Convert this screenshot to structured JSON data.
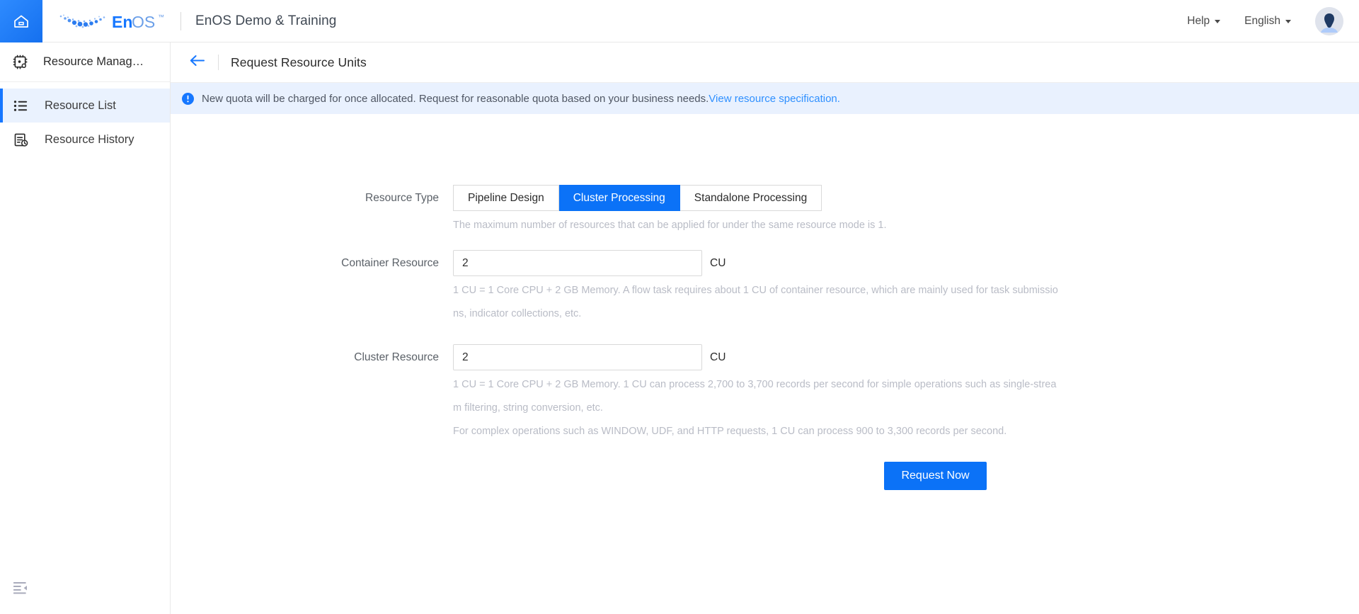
{
  "topbar": {
    "home_icon": "home-icon",
    "logo_text": "EnOS",
    "logo_tm": "™",
    "tenant_title": "EnOS Demo & Training",
    "help_label": "Help",
    "language_label": "English",
    "avatar_icon": "user-avatar-icon"
  },
  "sidebar": {
    "module_icon": "resource-chip-icon",
    "module_title": "Resource Manag…",
    "items": [
      {
        "label": "Resource List",
        "icon": "list-icon",
        "active": true
      },
      {
        "label": "Resource History",
        "icon": "history-document-icon",
        "active": false
      }
    ],
    "collapse_icon": "collapse-sidebar-icon"
  },
  "page": {
    "back_icon": "back-arrow-icon",
    "title": "Request Resource Units"
  },
  "notice": {
    "icon": "info-circle-icon",
    "text": "New quota will be charged for once allocated. Request for reasonable quota based on your business needs.",
    "link_text": "View resource specification."
  },
  "form": {
    "resource_type": {
      "label": "Resource Type",
      "options": [
        {
          "label": "Pipeline Design",
          "selected": false
        },
        {
          "label": "Cluster Processing",
          "selected": true
        },
        {
          "label": "Standalone Processing",
          "selected": false
        }
      ],
      "hint": "The maximum number of resources that can be applied for under the same resource mode is 1."
    },
    "container_resource": {
      "label": "Container Resource",
      "value": "2",
      "placeholder": "",
      "unit": "CU",
      "hint": "1 CU = 1 Core CPU + 2 GB Memory. A flow task requires about 1 CU of container resource, which are mainly used for task submissions, indicator collections, etc."
    },
    "cluster_resource": {
      "label": "Cluster Resource",
      "value": "2",
      "placeholder": "",
      "unit": "CU",
      "hint1": "1 CU = 1 Core CPU + 2 GB Memory. 1 CU can process 2,700 to 3,700 records per second for simple operations such as single-stream filtering, string conversion, etc.",
      "hint2": "For complex operations such as WINDOW, UDF, and HTTP requests, 1 CU can process 900 to 3,300 records per second."
    },
    "submit_label": "Request Now"
  },
  "colors": {
    "accent": "#0b72f7",
    "notice_bg": "#e9f1fe",
    "link": "#2f90ff",
    "sidebar_active_bg": "#eaf2fe",
    "hint_text": "#b9bcc6"
  }
}
